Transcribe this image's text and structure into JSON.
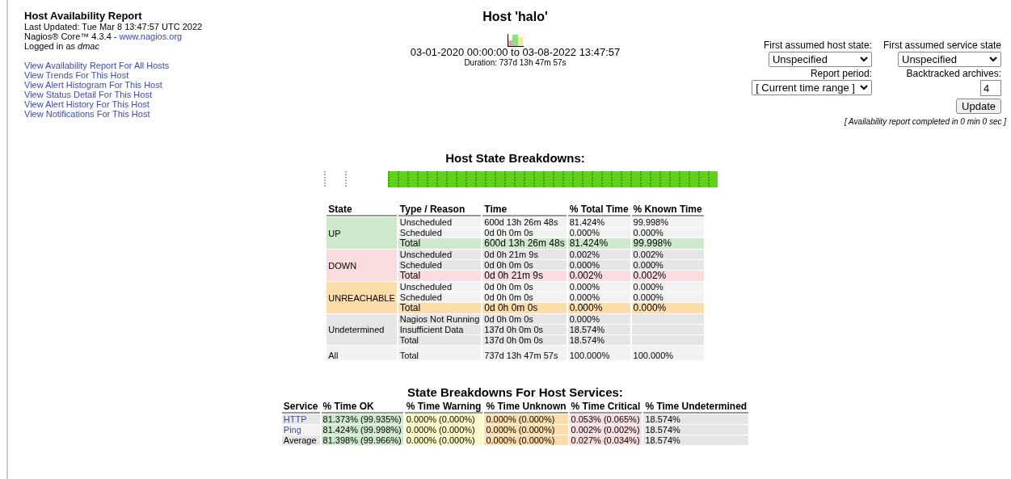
{
  "header": {
    "title": "Host Availability Report",
    "last_updated": "Last Updated: Tue Mar 8 13:47:57 UTC 2022",
    "version": "Nagios® Core™ 4.3.4 - ",
    "version_link": "www.nagios.org",
    "logged_in": "Logged in as *dmac*"
  },
  "links": [
    "View Availability Report For All Hosts",
    "View Trends For This Host",
    "View Alert Histogram For This Host",
    "View Status Detail For This Host",
    "View Alert History For This Host",
    "View Notifications For This Host"
  ],
  "report": {
    "title": "Host 'halo'",
    "range": "03-01-2020 00:00:00 to 03-08-2022 13:47:57",
    "duration": "Duration: 737d 13h 47m 57s"
  },
  "options": {
    "fields": [
      {
        "label": "First assumed host state:",
        "kind": "select",
        "value": "Unspecified"
      },
      {
        "label": "First assumed service state",
        "kind": "select",
        "value": "Unspecified"
      },
      {
        "label": "Report period:",
        "kind": "select",
        "value": "[ Current time range ]"
      },
      {
        "label": "Backtracked archives:",
        "kind": "input",
        "value": "4"
      }
    ],
    "update_button": "Update",
    "note": "[ Availability report completed in 0 min 0 sec ]"
  },
  "host_breakdown": {
    "title": "Host State Breakdowns:",
    "columns": [
      "State",
      "Type / Reason",
      "Time",
      "% Total Time",
      "% Known Time"
    ],
    "groups": [
      {
        "state": "UP",
        "kind": "up",
        "rows": [
          {
            "reason": "Unscheduled",
            "time": "600d 13h 26m 48s",
            "total": "81.424%",
            "known": "99.998%",
            "emphasized": false
          },
          {
            "reason": "Scheduled",
            "time": "0d 0h 0m 0s",
            "total": "0.000%",
            "known": "0.000%",
            "emphasized": false
          },
          {
            "reason": "Total",
            "time": "600d 13h 26m 48s",
            "total": "81.424%",
            "known": "99.998%",
            "emphasized": true
          }
        ]
      },
      {
        "state": "DOWN",
        "kind": "down",
        "rows": [
          {
            "reason": "Unscheduled",
            "time": "0d 0h 21m 9s",
            "total": "0.002%",
            "known": "0.002%",
            "emphasized": false
          },
          {
            "reason": "Scheduled",
            "time": "0d 0h 0m 0s",
            "total": "0.000%",
            "known": "0.000%",
            "emphasized": false
          },
          {
            "reason": "Total",
            "time": "0d 0h 21m 9s",
            "total": "0.002%",
            "known": "0.002%",
            "emphasized": true
          }
        ]
      },
      {
        "state": "UNREACHABLE",
        "kind": "unreachable",
        "rows": [
          {
            "reason": "Unscheduled",
            "time": "0d 0h 0m 0s",
            "total": "0.000%",
            "known": "0.000%",
            "emphasized": false
          },
          {
            "reason": "Scheduled",
            "time": "0d 0h 0m 0s",
            "total": "0.000%",
            "known": "0.000%",
            "emphasized": false
          },
          {
            "reason": "Total",
            "time": "0d 0h 0m 0s",
            "total": "0.000%",
            "known": "0.000%",
            "emphasized": true
          }
        ]
      },
      {
        "state": "Undetermined",
        "kind": "undetermined",
        "rows": [
          {
            "reason": "Nagios Not Running",
            "time": "0d 0h 0m 0s",
            "total": "0.000%",
            "emphasized": false
          },
          {
            "reason": "Insufficient Data",
            "time": "137d 0h 0m 0s",
            "total": "18.574%",
            "emphasized": false
          },
          {
            "reason": "Total",
            "time": "137d 0h 0m 0s",
            "total": "18.574%",
            "emphasized": false
          }
        ]
      },
      {
        "state": "All",
        "kind": "all",
        "rows": [
          {
            "reason": "Total",
            "time": "737d 13h 47m 57s",
            "total": "100.000%",
            "known": "100.000%",
            "emphasized": false
          }
        ]
      }
    ]
  },
  "services": {
    "title": "State Breakdowns For Host Services:",
    "columns": [
      "Service",
      "% Time OK",
      "% Time Warning",
      "% Time Unknown",
      "% Time Critical",
      "% Time Undetermined"
    ],
    "rows": [
      {
        "service": "HTTP",
        "link": true,
        "ok": "81.373% (99.935%)",
        "warning": "0.000% (0.000%)",
        "unknown": "0.000% (0.000%)",
        "critical": "0.053% (0.065%)",
        "undetermined": "18.574%"
      },
      {
        "service": "Ping",
        "link": true,
        "ok": "81.424% (99.998%)",
        "warning": "0.000% (0.000%)",
        "unknown": "0.000% (0.000%)",
        "critical": "0.002% (0.002%)",
        "undetermined": "18.574%"
      },
      {
        "service": "Average",
        "link": false,
        "ok": "81.398% (99.966%)",
        "warning": "0.000% (0.000%)",
        "unknown": "0.000% (0.000%)",
        "critical": "0.027% (0.034%)",
        "undetermined": "18.574%"
      }
    ]
  }
}
